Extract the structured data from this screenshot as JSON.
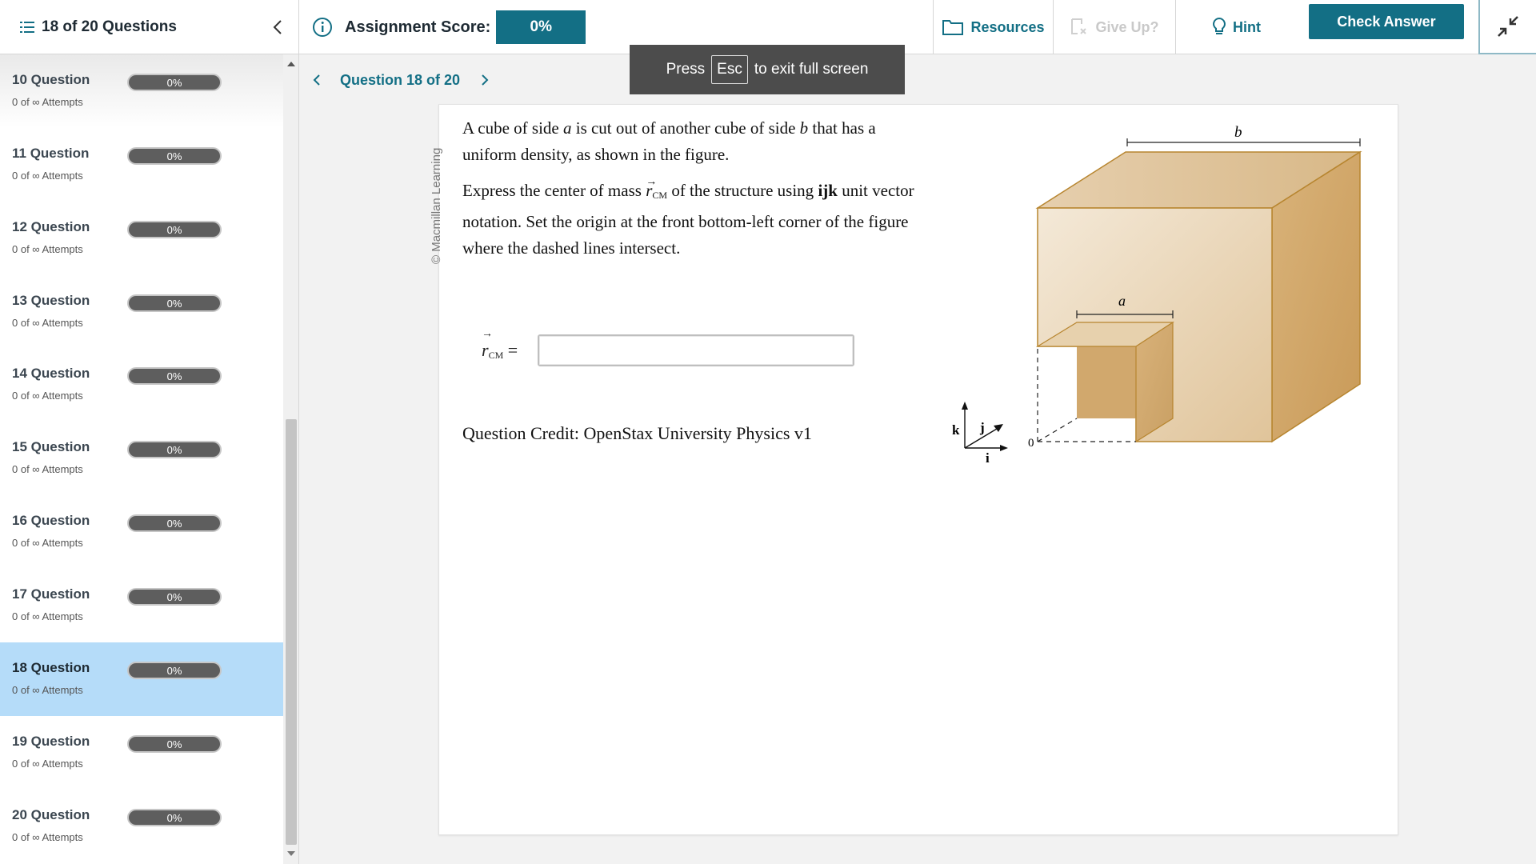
{
  "topbar": {
    "question_count": "18 of 20 Questions",
    "score_label": "Assignment Score:",
    "score_value": "0%",
    "resources_label": "Resources",
    "giveup_label": "Give Up?",
    "hint_label": "Hint",
    "check_answer_label": "Check Answer"
  },
  "sidebar": {
    "items": [
      {
        "title": "10 Question",
        "attempts": "0 of ∞ Attempts",
        "score": "0%"
      },
      {
        "title": "11 Question",
        "attempts": "0 of ∞ Attempts",
        "score": "0%"
      },
      {
        "title": "12 Question",
        "attempts": "0 of ∞ Attempts",
        "score": "0%"
      },
      {
        "title": "13 Question",
        "attempts": "0 of ∞ Attempts",
        "score": "0%"
      },
      {
        "title": "14 Question",
        "attempts": "0 of ∞ Attempts",
        "score": "0%"
      },
      {
        "title": "15 Question",
        "attempts": "0 of ∞ Attempts",
        "score": "0%"
      },
      {
        "title": "16 Question",
        "attempts": "0 of ∞ Attempts",
        "score": "0%"
      },
      {
        "title": "17 Question",
        "attempts": "0 of ∞ Attempts",
        "score": "0%"
      },
      {
        "title": "18 Question",
        "attempts": "0 of ∞ Attempts",
        "score": "0%"
      },
      {
        "title": "19 Question",
        "attempts": "0 of ∞ Attempts",
        "score": "0%"
      },
      {
        "title": "20 Question",
        "attempts": "0 of ∞ Attempts",
        "score": "0%"
      }
    ],
    "active_index": 8
  },
  "nav": {
    "label": "Question 18 of 20"
  },
  "fullscreen_notice": {
    "pre": "Press",
    "key": "Esc",
    "post": "to exit full screen"
  },
  "question": {
    "watermark": "© Macmillan Learning",
    "p1_a": "A cube of side ",
    "p1_var_a": "a",
    "p1_b": " is cut out of another cube of side ",
    "p1_var_b": "b",
    "p1_c": " that has a uniform density, as shown in the figure.",
    "p2_a": "Express the center of mass ",
    "p2_r": "r",
    "p2_sub": "CM",
    "p2_b": " of the structure using ",
    "p2_bold": "ijk",
    "p2_c": " unit vector notation. Set the origin at the front bottom-left corner of the figure where the dashed lines intersect.",
    "answer_r": "r",
    "answer_sub": "CM",
    "answer_eq": " =",
    "answer_value": "",
    "credit": "Question Credit: OpenStax University Physics v1"
  },
  "figure": {
    "label_b": "b",
    "label_a": "a",
    "axis_k": "k",
    "axis_j": "j",
    "axis_i": "i",
    "origin": "0"
  },
  "colors": {
    "accent": "#136f85",
    "active_row": "#b5dcf9",
    "pill": "#5e5e5e",
    "cube_light": "#f3e6d2",
    "cube_dark": "#c99a58"
  }
}
